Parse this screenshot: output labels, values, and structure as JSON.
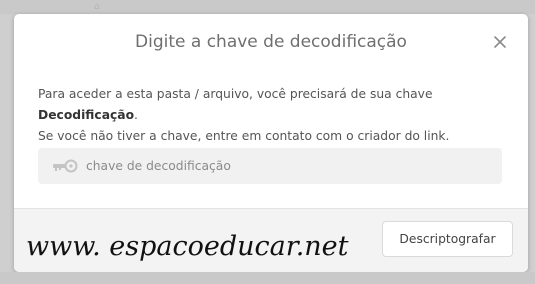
{
  "dialog": {
    "title": "Digite a chave de decodificação",
    "description_part1": "Para aceder a esta pasta / arquivo, você precisará de sua chave ",
    "description_bold": "Decodificação",
    "description_part2": ".",
    "description_line2": "Se você não tiver a chave, entre em contato com o criador do link.",
    "key_input": {
      "placeholder": "chave de decodificação",
      "value": "",
      "icon": "key-icon"
    },
    "decrypt_button_label": "Descriptografar",
    "close_icon": "close-icon"
  },
  "watermark": {
    "text": "www. espacoeducar.net"
  },
  "colors": {
    "backdrop": "#cfcfcf",
    "modal_bg": "#ffffff",
    "footer_bg": "#f3f3f3",
    "field_bg": "#f1f1f1",
    "title_text": "#6f6f6f"
  }
}
